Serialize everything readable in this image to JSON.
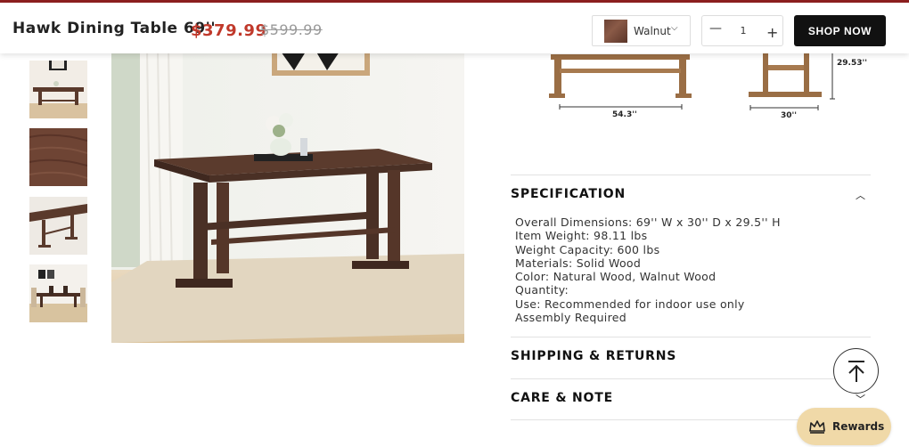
{
  "header": {
    "title": "Hawk Dining Table 69''",
    "price": "$379.99",
    "old_price": "$599.99",
    "variant": {
      "label": "Walnut",
      "swatch_color": "#6b4234"
    },
    "quantity": "1",
    "minus_symbol": "—",
    "plus_symbol": "+",
    "shop_now_label": "SHOP NOW"
  },
  "dimensions": {
    "width_label": "54.3''",
    "height_label": "29.53''",
    "depth_label": "30''"
  },
  "accordion": {
    "specification": {
      "title": "SPECIFICATION",
      "items": [
        "Overall Dimensions: 69'' W x 30'' D x 29.5'' H",
        "Item Weight: 98.11 lbs",
        "Weight Capacity: 600 lbs",
        "Materials: Solid Wood",
        "Color: Natural Wood, Walnut Wood",
        "Quantity:",
        "Use: Recommended for indoor use only",
        "Assembly Required"
      ]
    },
    "shipping": {
      "title": "SHIPPING & RETURNS"
    },
    "care": {
      "title": "CARE & NOTE"
    }
  },
  "floating": {
    "rewards_label": "Rewards"
  },
  "colors": {
    "accent_red": "#c0392b",
    "shop_button": "#111111",
    "rewards_bg": "#f0d9a8",
    "wood_walnut": "#5a3a2c",
    "wood_natural": "#9a6e45"
  }
}
